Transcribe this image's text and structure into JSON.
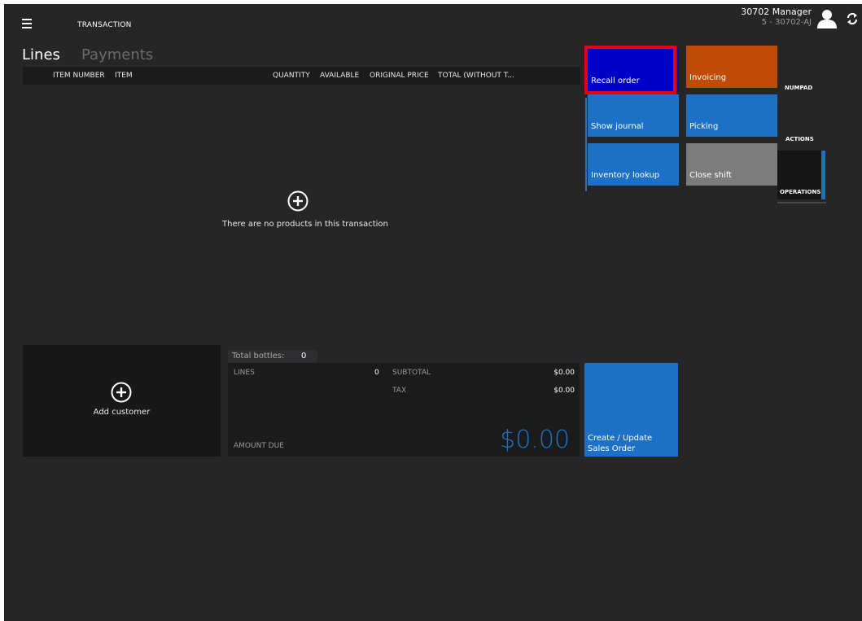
{
  "header": {
    "screen_title": "TRANSACTION",
    "user_name": "30702 Manager",
    "store_terminal": "5 - 30702-AJ",
    "icons": {
      "menu": "hamburger-menu-icon",
      "user": "user-avatar-icon",
      "refresh": "refresh-icon"
    }
  },
  "tabs": [
    {
      "label": "Lines",
      "active": true
    },
    {
      "label": "Payments",
      "active": false
    }
  ],
  "grid": {
    "columns": [
      "ITEM NUMBER",
      "ITEM",
      "QUANTITY",
      "AVAILABLE",
      "ORIGINAL PRICE",
      "TOTAL (WITHOUT T..."
    ],
    "empty_message": "There are no products in this transaction"
  },
  "customer": {
    "add_label": "Add customer"
  },
  "totals": {
    "total_bottles_label": "Total bottles:",
    "total_bottles_value": "0",
    "lines_label": "LINES",
    "lines_value": "0",
    "subtotal_label": "SUBTOTAL",
    "subtotal_value": "$0.00",
    "tax_label": "TAX",
    "tax_value": "$0.00",
    "amount_due_label": "AMOUNT DUE",
    "amount_due_value": "$0.00"
  },
  "action_tile": {
    "label": "Create / Update Sales Order"
  },
  "buttons": {
    "recall_order": "Recall order",
    "invoicing": "Invoicing",
    "show_journal": "Show journal",
    "picking": "Picking",
    "inventory_lookup": "Inventory lookup",
    "close_shift": "Close shift"
  },
  "side_tabs": {
    "numpad": "NUMPAD",
    "actions": "ACTIONS",
    "operations": "OPERATIONS"
  },
  "colors": {
    "background": "#262627",
    "tile_blue": "#1c71c7",
    "recall_blue": "#0000c9",
    "invoicing_orange": "#c04b04",
    "close_shift_gray": "#7c7c7c",
    "highlight_red": "#e2040a",
    "amount_due_blue": "#1c74c9"
  }
}
